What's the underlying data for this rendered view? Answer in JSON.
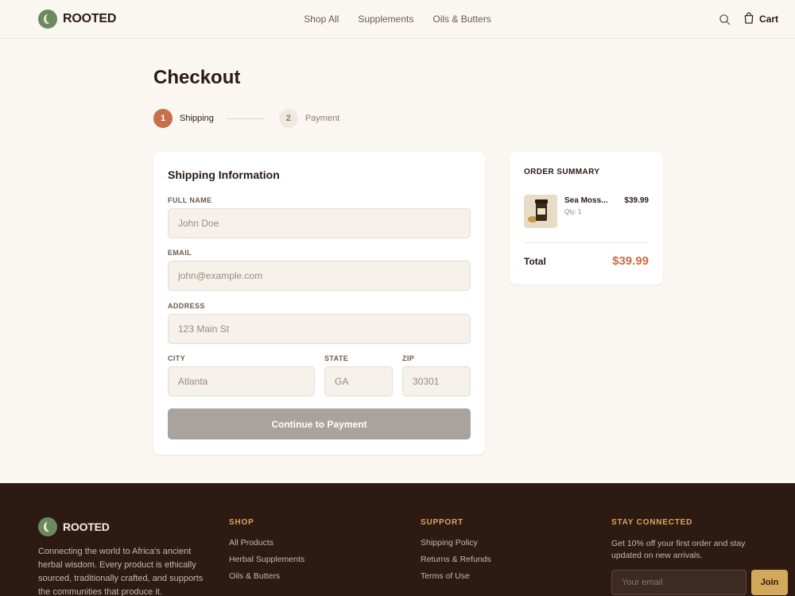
{
  "brand": {
    "name": "ROOTED"
  },
  "nav": {
    "items": [
      "Shop All",
      "Supplements",
      "Oils & Butters"
    ]
  },
  "header": {
    "cart_label": "Cart"
  },
  "checkout": {
    "title": "Checkout",
    "steps": [
      {
        "number": "1",
        "label": "Shipping",
        "active": true
      },
      {
        "number": "2",
        "label": "Payment",
        "active": false
      }
    ]
  },
  "shipping": {
    "title": "Shipping Information",
    "full_name": {
      "label": "FULL NAME",
      "placeholder": "John Doe"
    },
    "email": {
      "label": "EMAIL",
      "placeholder": "john@example.com"
    },
    "address": {
      "label": "ADDRESS",
      "placeholder": "123 Main St"
    },
    "city": {
      "label": "CITY",
      "placeholder": "Atlanta"
    },
    "state": {
      "label": "STATE",
      "placeholder": "GA"
    },
    "zip": {
      "label": "ZIP",
      "placeholder": "30301"
    },
    "submit_label": "Continue to Payment"
  },
  "summary": {
    "title": "ORDER SUMMARY",
    "item": {
      "name": "Sea Moss...",
      "qty": "Qty: 1",
      "price": "$39.99"
    },
    "total_label": "Total",
    "total_value": "$39.99"
  },
  "footer": {
    "brand": "ROOTED",
    "description": "Connecting the world to Africa's ancient herbal wisdom. Every product is ethically sourced, traditionally crafted, and supports the communities that produce it.",
    "shop": {
      "title": "SHOP",
      "links": [
        "All Products",
        "Herbal Supplements",
        "Oils & Butters"
      ]
    },
    "support": {
      "title": "SUPPORT",
      "links": [
        "Shipping Policy",
        "Returns & Refunds",
        "Terms of Use"
      ]
    },
    "newsletter": {
      "title": "STAY CONNECTED",
      "text": "Get 10% off your first order and stay updated on new arrivals.",
      "placeholder": "Your email",
      "button": "Join"
    }
  },
  "colors": {
    "accent": "#c5704a",
    "brand_green": "#6b8a5e",
    "footer_bg": "#2d1a12",
    "gold": "#d4a85a"
  }
}
